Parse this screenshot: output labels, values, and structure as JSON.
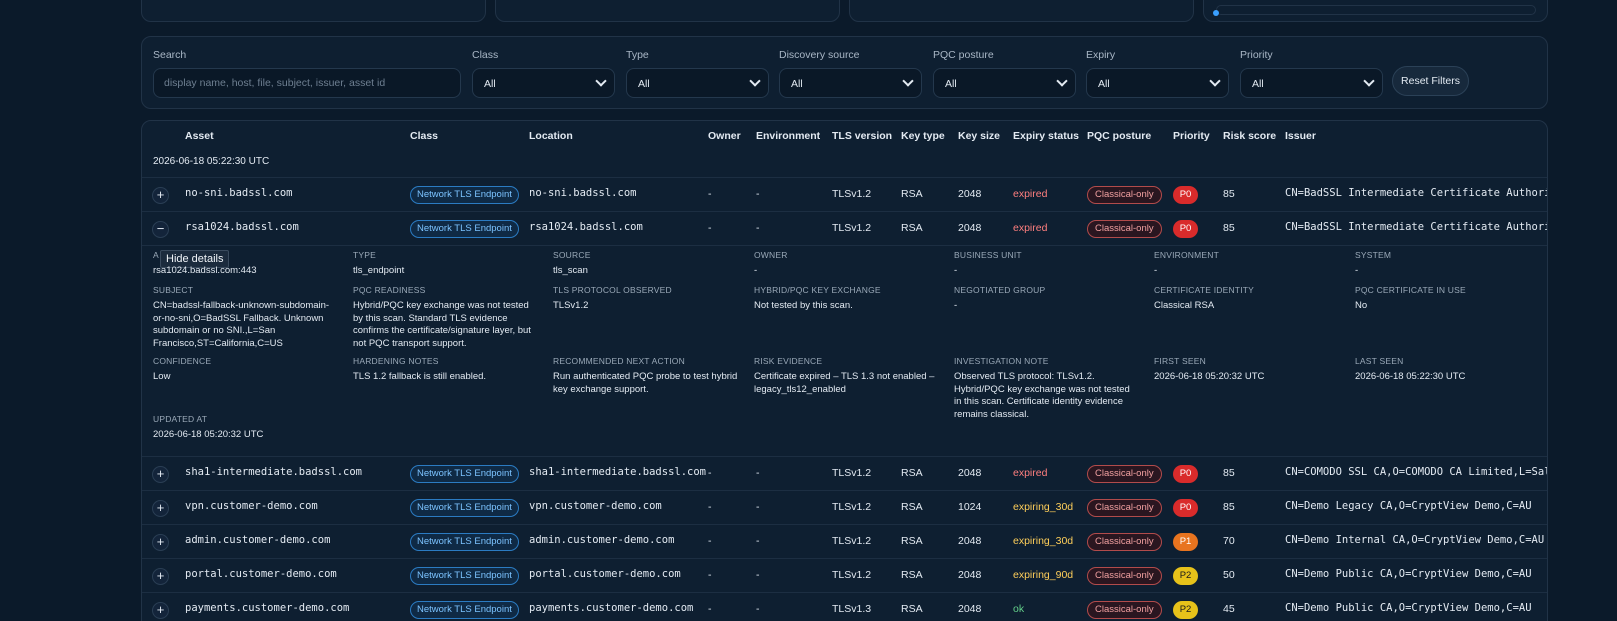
{
  "filters": {
    "search": {
      "label": "Search",
      "placeholder": "display name, host, file, subject, issuer, asset id"
    },
    "selects": [
      {
        "label": "Class",
        "value": "All"
      },
      {
        "label": "Type",
        "value": "All"
      },
      {
        "label": "Discovery source",
        "value": "All"
      },
      {
        "label": "PQC posture",
        "value": "All"
      },
      {
        "label": "Expiry",
        "value": "All"
      },
      {
        "label": "Priority",
        "value": "All"
      }
    ],
    "reset_label": "Reset Filters"
  },
  "table": {
    "columns": [
      "Asset",
      "Class",
      "Location",
      "Owner",
      "Environment",
      "TLS version",
      "Key type",
      "Key size",
      "Expiry status",
      "PQC posture",
      "Priority",
      "Risk score",
      "Issuer"
    ],
    "group_label": "2026-06-18 05:22:30 UTC",
    "rows": [
      {
        "toggle": "+",
        "asset": "no-sni.badssl.com",
        "class": "Network TLS Endpoint",
        "location": "no-sni.badssl.com",
        "owner": "-",
        "environment": "-",
        "tls": "TLSv1.2",
        "key_type": "RSA",
        "key_size": "2048",
        "expiry": "expired",
        "pqc": "Classical-only",
        "priority": "P0",
        "risk": "85",
        "issuer": "CN=BadSSL Intermediate Certificate Authority,O"
      },
      {
        "toggle": "−",
        "asset": "rsa1024.badssl.com",
        "class": "Network TLS Endpoint",
        "location": "rsa1024.badssl.com",
        "owner": "-",
        "environment": "-",
        "tls": "TLSv1.2",
        "key_type": "RSA",
        "key_size": "2048",
        "expiry": "expired",
        "pqc": "Classical-only",
        "priority": "P0",
        "risk": "85",
        "issuer": "CN=BadSSL Intermediate Certificate Authority,O"
      },
      {
        "toggle": "+",
        "asset": "sha1-intermediate.badssl.com",
        "class": "Network TLS Endpoint",
        "location": "sha1-intermediate.badssl.com",
        "owner": "-",
        "environment": "-",
        "tls": "TLSv1.2",
        "key_type": "RSA",
        "key_size": "2048",
        "expiry": "expired",
        "pqc": "Classical-only",
        "priority": "P0",
        "risk": "85",
        "issuer": "CN=COMODO SSL CA,O=COMODO CA Limited,L=Salford"
      },
      {
        "toggle": "+",
        "asset": "vpn.customer-demo.com",
        "class": "Network TLS Endpoint",
        "location": "vpn.customer-demo.com",
        "owner": "-",
        "environment": "-",
        "tls": "TLSv1.2",
        "key_type": "RSA",
        "key_size": "1024",
        "expiry": "expiring_30d",
        "pqc": "Classical-only",
        "priority": "P0",
        "risk": "85",
        "issuer": "CN=Demo Legacy CA,O=CryptView Demo,C=AU"
      },
      {
        "toggle": "+",
        "asset": "admin.customer-demo.com",
        "class": "Network TLS Endpoint",
        "location": "admin.customer-demo.com",
        "owner": "-",
        "environment": "-",
        "tls": "TLSv1.2",
        "key_type": "RSA",
        "key_size": "2048",
        "expiry": "expiring_30d",
        "pqc": "Classical-only",
        "priority": "P1",
        "risk": "70",
        "issuer": "CN=Demo Internal CA,O=CryptView Demo,C=AU"
      },
      {
        "toggle": "+",
        "asset": "portal.customer-demo.com",
        "class": "Network TLS Endpoint",
        "location": "portal.customer-demo.com",
        "owner": "-",
        "environment": "-",
        "tls": "TLSv1.2",
        "key_type": "RSA",
        "key_size": "2048",
        "expiry": "expiring_90d",
        "pqc": "Classical-only",
        "priority": "P2",
        "risk": "50",
        "issuer": "CN=Demo Public CA,O=CryptView Demo,C=AU"
      },
      {
        "toggle": "+",
        "asset": "payments.customer-demo.com",
        "class": "Network TLS Endpoint",
        "location": "payments.customer-demo.com",
        "owner": "-",
        "environment": "-",
        "tls": "TLSv1.3",
        "key_type": "RSA",
        "key_size": "2048",
        "expiry": "ok",
        "pqc": "Classical-only",
        "priority": "P2",
        "risk": "45",
        "issuer": "CN=Demo Public CA,O=CryptView Demo,C=AU"
      }
    ]
  },
  "details": {
    "tooltip": "Hide details",
    "asset_id_label": "A",
    "asset_id_value": "rsa1024.badssl.com:443",
    "fields": [
      {
        "label": "TYPE",
        "value": "tls_endpoint"
      },
      {
        "label": "SOURCE",
        "value": "tls_scan"
      },
      {
        "label": "OWNER",
        "value": "-"
      },
      {
        "label": "BUSINESS UNIT",
        "value": "-"
      },
      {
        "label": "ENVIRONMENT",
        "value": "-"
      },
      {
        "label": "SYSTEM",
        "value": "-"
      },
      {
        "label": "SUBJECT",
        "value": "CN=badssl-fallback-unknown-subdomain-or-no-sni,O=BadSSL Fallback. Unknown subdomain or no SNI.,L=San Francisco,ST=California,C=US"
      },
      {
        "label": "PQC READINESS",
        "value": "Hybrid/PQC key exchange was not tested by this scan. Standard TLS evidence confirms the certificate/signature layer, but not PQC transport support."
      },
      {
        "label": "TLS PROTOCOL OBSERVED",
        "value": "TLSv1.2"
      },
      {
        "label": "HYBRID/PQC KEY EXCHANGE",
        "value": "Not tested by this scan."
      },
      {
        "label": "NEGOTIATED GROUP",
        "value": "-"
      },
      {
        "label": "CERTIFICATE IDENTITY",
        "value": "Classical RSA"
      },
      {
        "label": "PQC CERTIFICATE IN USE",
        "value": "No"
      },
      {
        "label": "CONFIDENCE",
        "value": "Low"
      },
      {
        "label": "HARDENING NOTES",
        "value": "TLS 1.2 fallback is still enabled."
      },
      {
        "label": "RECOMMENDED NEXT ACTION",
        "value": "Run authenticated PQC probe to test hybrid key exchange support."
      },
      {
        "label": "RISK EVIDENCE",
        "value": "Certificate expired – TLS 1.3 not enabled – legacy_tls12_enabled"
      },
      {
        "label": "INVESTIGATION NOTE",
        "value": "Observed TLS protocol: TLSv1.2. Hybrid/PQC key exchange was not tested in this scan. Certificate identity evidence remains classical."
      },
      {
        "label": "FIRST SEEN",
        "value": "2026-06-18 05:20:32 UTC"
      },
      {
        "label": "LAST SEEN",
        "value": "2026-06-18 05:22:30 UTC"
      },
      {
        "label": "UPDATED AT",
        "value": "2026-06-18 05:20:32 UTC"
      }
    ]
  }
}
